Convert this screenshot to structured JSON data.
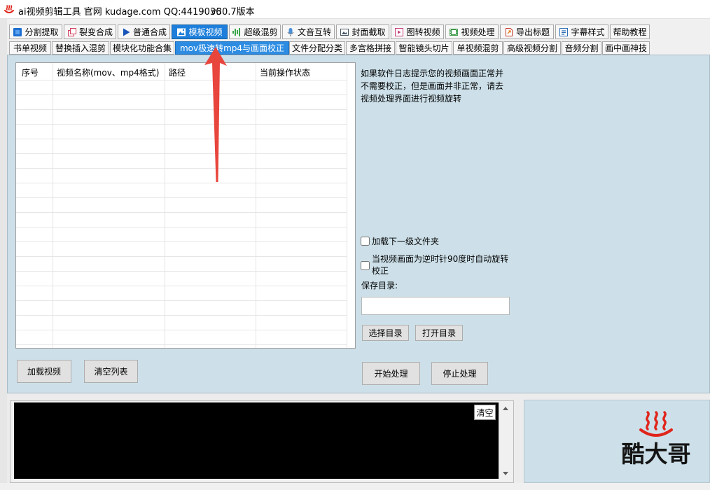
{
  "window": {
    "title": "ai视频剪辑工具 官网 kudage.com QQ:4419036",
    "version": "v30.7版本",
    "logo_icon": "hot-spring-logo-icon"
  },
  "theme": {
    "selected_tab": "#1d7fdb",
    "panel_bg": "#cde0e9",
    "logo_red": "#e0251b",
    "annotation_arrow": "#e8453c"
  },
  "main_tabs": [
    {
      "label": "分割提取",
      "icon": "split-icon"
    },
    {
      "label": "裂变合成",
      "icon": "fission-icon"
    },
    {
      "label": "普通合成",
      "icon": "play-icon"
    },
    {
      "label": "模板视频",
      "icon": "template-icon",
      "selected": true
    },
    {
      "label": "超级混剪",
      "icon": "audio-bars-icon"
    },
    {
      "label": "文音互转",
      "icon": "microphone-icon"
    },
    {
      "label": "封面截取",
      "icon": "picture-icon"
    },
    {
      "label": "图转视频",
      "icon": "image-to-video-icon"
    },
    {
      "label": "视频处理",
      "icon": "film-icon"
    },
    {
      "label": "导出标题",
      "icon": "export-icon"
    },
    {
      "label": "字幕样式",
      "icon": "subtitle-icon"
    },
    {
      "label": "帮助教程"
    }
  ],
  "sub_tabs": [
    {
      "label": "书单视频"
    },
    {
      "label": "替换插入混剪"
    },
    {
      "label": "模块化功能合集"
    },
    {
      "label": "mov极速转mp4与画面校正",
      "selected": true
    },
    {
      "label": "文件分配分类"
    },
    {
      "label": "多宫格拼接"
    },
    {
      "label": "智能镜头切片"
    },
    {
      "label": "单视频混剪"
    },
    {
      "label": "高级视频分割"
    },
    {
      "label": "音频分割"
    },
    {
      "label": "画中画神技"
    }
  ],
  "file_table": {
    "columns": [
      "序号",
      "视频名称(mov、mp4格式)",
      "路径",
      "当前操作状态"
    ],
    "rows": []
  },
  "notice": "如果软件日志提示您的视频画面正常并不需要校正，但是画面并非正常，请去视频处理界面进行视频旋转",
  "options": {
    "load_subfolders": {
      "label": "加载下一级文件夹",
      "checked": false
    },
    "auto_rotate": {
      "label": "当视频画面为逆时针90度时自动旋转校正",
      "checked": false
    }
  },
  "save_dir": {
    "label": "保存目录:",
    "value": ""
  },
  "buttons": {
    "choose_dir": "选择目录",
    "open_dir": "打开目录",
    "start": "开始处理",
    "stop": "停止处理",
    "load_videos": "加载视频",
    "clear_list": "清空列表"
  },
  "log": {
    "clear_label": "清空"
  },
  "brand": {
    "name": "酷大哥",
    "icon": "hot-spring-logo-icon"
  }
}
